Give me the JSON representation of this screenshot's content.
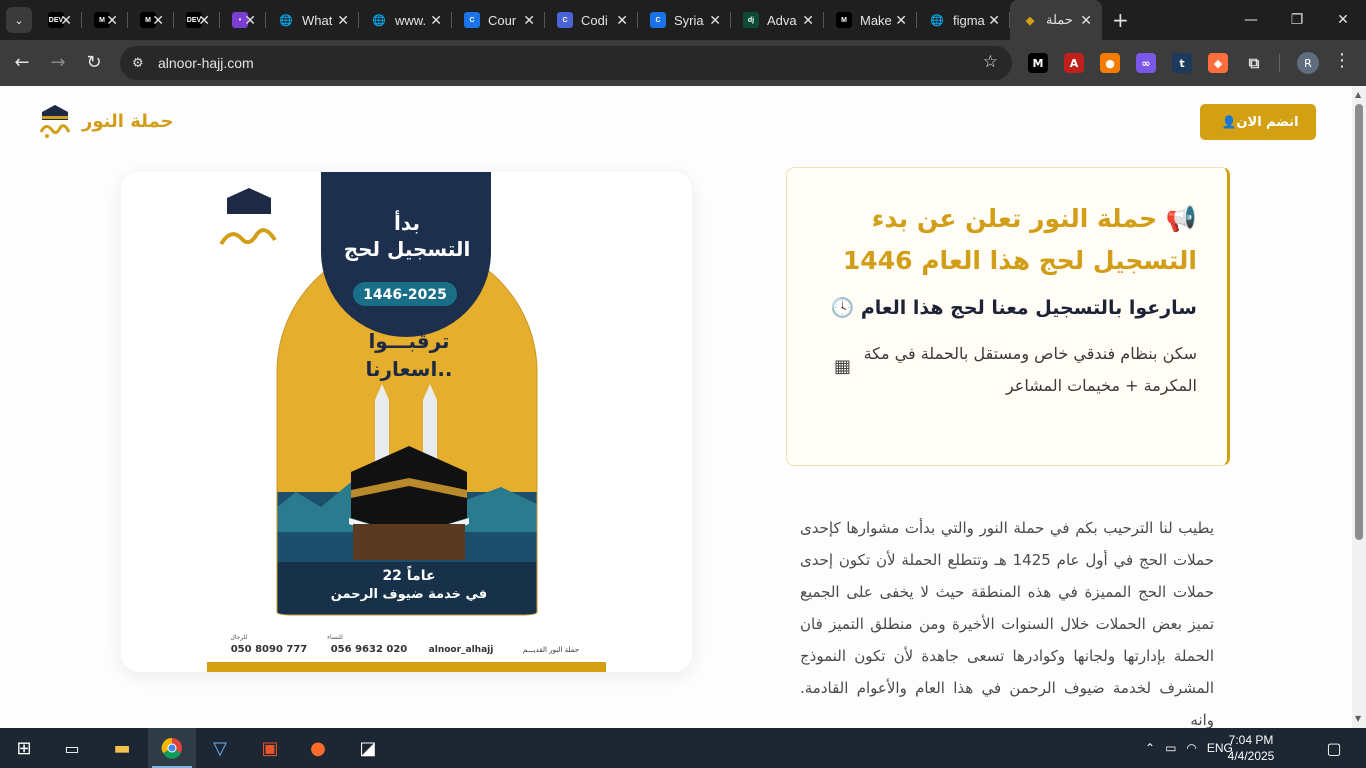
{
  "browser": {
    "tabs": [
      {
        "title": "",
        "favicon": "DEV",
        "color": "#000000"
      },
      {
        "title": "",
        "favicon": "M",
        "color": "#000000"
      },
      {
        "title": "",
        "favicon": "M",
        "color": "#000000"
      },
      {
        "title": "",
        "favicon": "DEV",
        "color": "#000000"
      },
      {
        "title": "",
        "favicon": "•",
        "color": "#7a3fd1"
      },
      {
        "title": "What",
        "favicon": "globe-icon",
        "color": "#555555"
      },
      {
        "title": "www.",
        "favicon": "globe-icon",
        "color": "#555555"
      },
      {
        "title": "Cour",
        "favicon": "C",
        "color": "#1a73e8"
      },
      {
        "title": "Codi",
        "favicon": "C",
        "color": "#4a64d8"
      },
      {
        "title": "Syria",
        "favicon": "C",
        "color": "#1a73e8"
      },
      {
        "title": "Adva",
        "favicon": "dj",
        "color": "#0c4b33"
      },
      {
        "title": "Make",
        "favicon": "M",
        "color": "#000000"
      },
      {
        "title": "figma",
        "favicon": "globe-icon",
        "color": "#555555"
      },
      {
        "title": "حملة",
        "favicon": "logo",
        "color": "#d39e17"
      }
    ],
    "url": "alnoor-hajj.com",
    "profile_initial": "R",
    "extensions": [
      {
        "label": "M",
        "color": "#000000"
      },
      {
        "label": "A",
        "color": "#c0201c"
      },
      {
        "label": "●",
        "color": "#f57c00"
      },
      {
        "label": "∞",
        "color": "#7b57e8"
      },
      {
        "label": "t",
        "color": "#1c3a5e"
      },
      {
        "label": "◆",
        "color": "#ff6d3a"
      }
    ]
  },
  "site": {
    "brand_name": "حملة النور",
    "join_button": "انضم الان",
    "colors": {
      "gold": "#d39e17",
      "navy": "#1e2a44"
    },
    "poster": {
      "header_line1": "بدأ",
      "header_line2": "التسجيل لحج",
      "years": "1446-2025",
      "teaser_line1": "ترقبـــوا",
      "teaser_line2": "اسعارنا..",
      "years_service": "22 عاماً",
      "service_text": "في خدمة ضيوف الرحمن",
      "contact_men_label": "للرجال",
      "contact_men": "050 8090 777",
      "contact_women_label": "للنساء",
      "contact_women": "056 9632 020",
      "instagram": "alnoor_alhajj",
      "snapchat": "حملة النور القديـــم"
    },
    "announcement": {
      "title": "حملة النور تعلن عن بدء التسجيل لحج هذا العام 1446",
      "subtitle": "سارعوا بالتسجيل معنا لحج هذا العام",
      "feature": "سكن بنظام فندقي خاص ومستقل بالحملة في مكة المكرمة + مخيمات المشاعر"
    },
    "about_text": "يطيب لنا الترحيب بكم في حملة النور والتي بدأت مشوارها كإحدى حملات الحج في أول عام 1425 هـ وتتطلع الحملة لأن تكون إحدى حملات الحج المميزة في هذه المنطقة حيث لا يخفى على الجميع تميز بعض الحملات خلال السنوات الأخيرة ومن منطلق التميز فان الحملة بإدارتها ولجانها وكوادرها تسعى جاهدة لأن تكون النموذج المشرف لخدمة ضيوف الرحمن في هذا العام والأعوام القادمة. وانه"
  },
  "taskbar": {
    "language": "ENG",
    "time": "7:04 PM",
    "date": "4/4/2025"
  }
}
